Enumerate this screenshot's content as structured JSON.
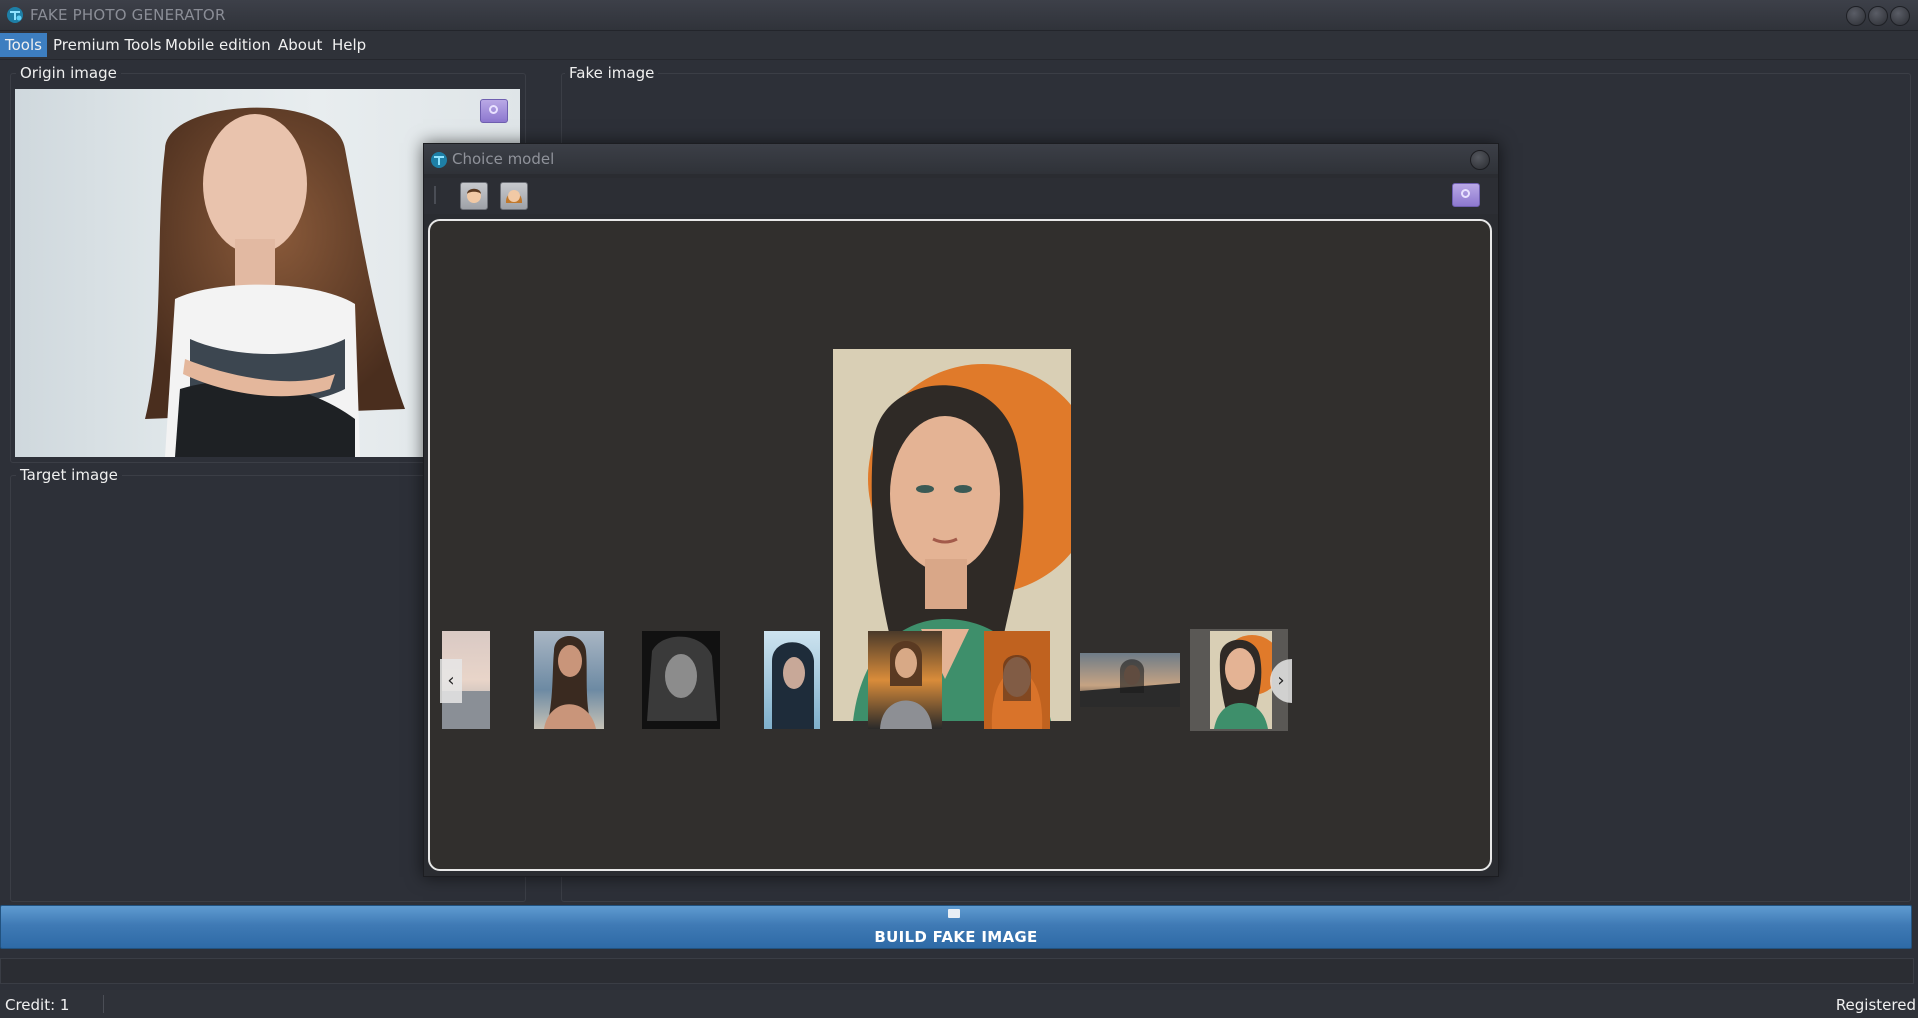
{
  "app": {
    "title": "FAKE PHOTO GENERATOR"
  },
  "menu": {
    "items": [
      {
        "label": "Tools",
        "active": true
      },
      {
        "label": "Premium Tools"
      },
      {
        "label": "Mobile edition"
      },
      {
        "label": "About"
      },
      {
        "label": "Help"
      }
    ]
  },
  "panels": {
    "origin_label": "Origin image",
    "target_label": "Target image",
    "fake_label": "Fake  image"
  },
  "dialog": {
    "title": "Choice model",
    "toolbar": {
      "male_icon": "man-face-icon",
      "female_icon": "woman-face-icon"
    },
    "thumbnail_count": 8,
    "selected_thumbnail": 8
  },
  "build_button": {
    "label": "BUILD FAKE IMAGE",
    "icon": "image-icon"
  },
  "status": {
    "credit": "Credit: 1",
    "registration": "Registered"
  },
  "colors": {
    "accent": "#3d7ec0",
    "background": "#2d3038",
    "button": "#3f7ab5"
  }
}
